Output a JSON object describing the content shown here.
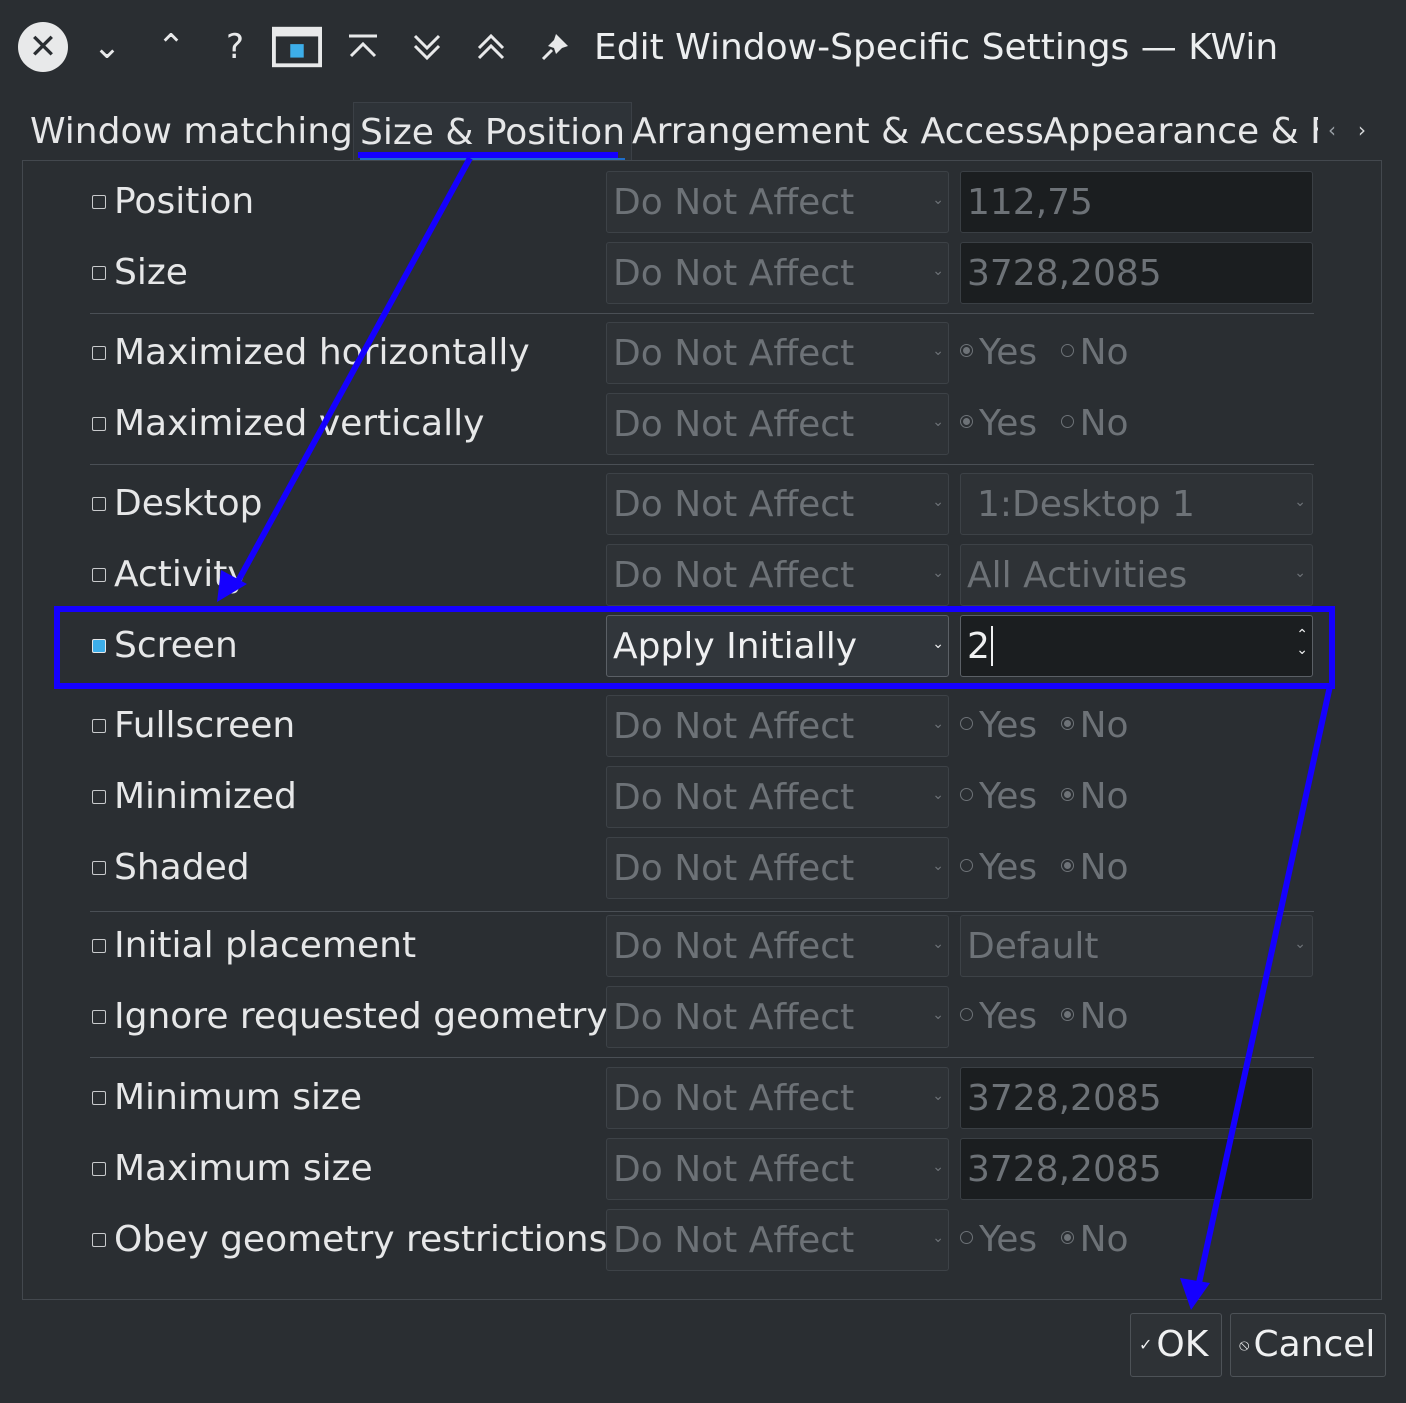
{
  "window": {
    "title": "Edit Window-Specific Settings — KWin",
    "accent_color": "#3daee9",
    "annotation_color": "#1500ff"
  },
  "titlebar_icons": [
    "close-icon",
    "chevron-down-icon",
    "chevron-up-icon",
    "help-icon",
    "window-menu-icon",
    "keep-above-icon",
    "keep-below-icon",
    "shade-icon",
    "pin-icon"
  ],
  "tabs": [
    {
      "label": "Window matching"
    },
    {
      "label": "Size & Position"
    },
    {
      "label": "Arrangement & Access"
    },
    {
      "label": "Appearance & F"
    }
  ],
  "tab_scroll": {
    "left": "‹",
    "right": "›"
  },
  "rows": [
    {
      "label": "Position",
      "policy": "Do Not Affect",
      "value": "112,75",
      "checked": false
    },
    {
      "label": "Size",
      "policy": "Do Not Affect",
      "value": "3728,2085",
      "checked": false
    },
    {
      "label": "Maximized horizontally",
      "policy": "Do Not Affect",
      "yes": "Yes",
      "no": "No",
      "selected": "Yes",
      "checked": false
    },
    {
      "label": "Maximized vertically",
      "policy": "Do Not Affect",
      "yes": "Yes",
      "no": "No",
      "selected": "Yes",
      "checked": false
    },
    {
      "label": "Desktop",
      "policy": "Do Not Affect",
      "value": "1:Desktop 1",
      "checked": false
    },
    {
      "label": "Activity",
      "policy": "Do Not Affect",
      "value": "All Activities",
      "checked": false
    },
    {
      "label": "Screen",
      "policy": "Apply Initially",
      "value": "2",
      "checked": true
    },
    {
      "label": "Fullscreen",
      "policy": "Do Not Affect",
      "yes": "Yes",
      "no": "No",
      "selected": "No",
      "checked": false
    },
    {
      "label": "Minimized",
      "policy": "Do Not Affect",
      "yes": "Yes",
      "no": "No",
      "selected": "No",
      "checked": false
    },
    {
      "label": "Shaded",
      "policy": "Do Not Affect",
      "yes": "Yes",
      "no": "No",
      "selected": "No",
      "checked": false
    },
    {
      "label": "Initial placement",
      "policy": "Do Not Affect",
      "value": "Default",
      "checked": false
    },
    {
      "label": "Ignore requested geometry",
      "policy": "Do Not Affect",
      "yes": "Yes",
      "no": "No",
      "selected": "No",
      "checked": false
    },
    {
      "label": "Minimum size",
      "policy": "Do Not Affect",
      "value": "3728,2085",
      "checked": false
    },
    {
      "label": "Maximum size",
      "policy": "Do Not Affect",
      "value": "3728,2085",
      "checked": false
    },
    {
      "label": "Obey geometry restrictions",
      "policy": "Do Not Affect",
      "yes": "Yes",
      "no": "No",
      "selected": "No",
      "checked": false
    }
  ],
  "buttons": {
    "ok": "OK",
    "cancel": "Cancel"
  }
}
